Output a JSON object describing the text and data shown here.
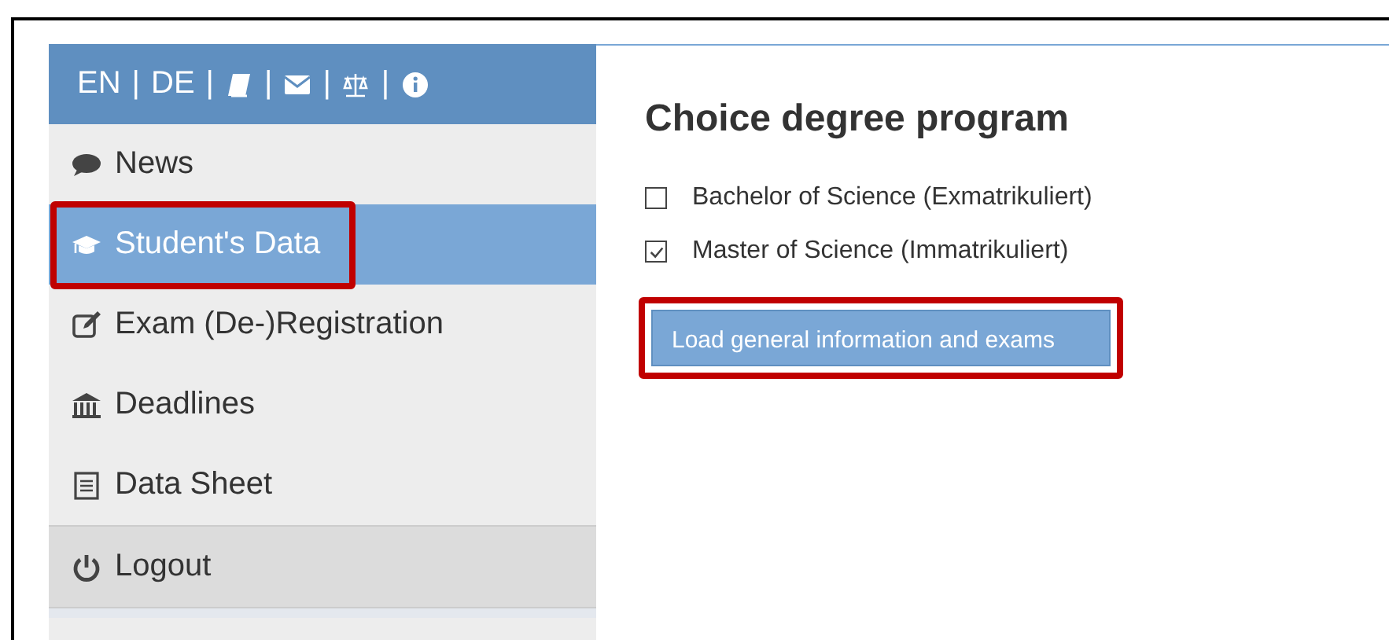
{
  "header": {
    "items": [
      {
        "kind": "link",
        "label": "EN"
      },
      {
        "kind": "separator",
        "label": "|"
      },
      {
        "kind": "link",
        "label": "DE"
      },
      {
        "kind": "separator",
        "label": "|"
      },
      {
        "kind": "icon"
      },
      {
        "kind": "separator",
        "label": "|"
      },
      {
        "kind": "icon"
      },
      {
        "kind": "separator",
        "label": "|"
      },
      {
        "kind": "icon"
      },
      {
        "kind": "separator",
        "label": "|"
      },
      {
        "kind": "icon"
      }
    ]
  },
  "sidebar": {
    "items": [
      {
        "label": "News",
        "selected": false,
        "highlighted": false,
        "kind": "nav"
      },
      {
        "label": "Student's Data",
        "selected": true,
        "highlighted": true,
        "kind": "nav"
      },
      {
        "label": "Exam (De-)Registration",
        "selected": false,
        "highlighted": false,
        "kind": "nav"
      },
      {
        "label": "Deadlines",
        "selected": false,
        "highlighted": false,
        "kind": "nav"
      },
      {
        "label": "Data Sheet",
        "selected": false,
        "highlighted": false,
        "kind": "nav"
      },
      {
        "label": "Logout",
        "selected": false,
        "highlighted": false,
        "kind": "logout"
      }
    ]
  },
  "content": {
    "title": "Choice degree program",
    "options": [
      {
        "label": "Bachelor of Science (Exmatrikuliert)",
        "checked": false
      },
      {
        "label": "Master of Science (Immatrikuliert)",
        "checked": true
      }
    ],
    "button": {
      "label": "Load general information and exams",
      "highlighted": true
    }
  }
}
